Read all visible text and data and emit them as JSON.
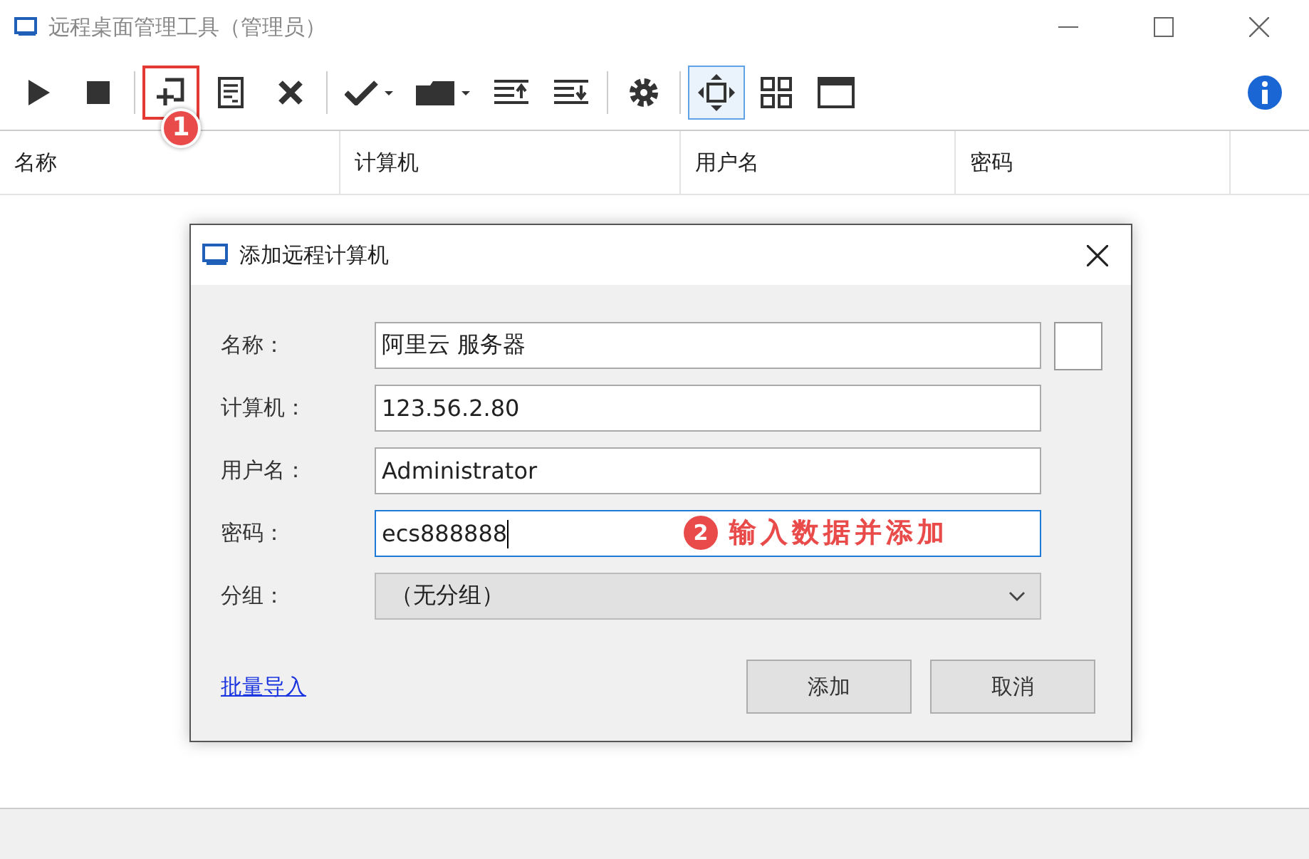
{
  "window": {
    "title": "远程桌面管理工具（管理员）"
  },
  "toolbar": [
    {
      "kind": "play",
      "selected": false
    },
    {
      "kind": "stop",
      "selected": false
    },
    {
      "kind": "separator"
    },
    {
      "kind": "add",
      "selected": false,
      "callout": "1"
    },
    {
      "kind": "properties",
      "selected": false
    },
    {
      "kind": "delete",
      "selected": false
    },
    {
      "kind": "separator"
    },
    {
      "kind": "check",
      "selected": false
    },
    {
      "kind": "folder",
      "selected": false
    },
    {
      "kind": "align-top",
      "selected": false
    },
    {
      "kind": "align-bottom",
      "selected": false
    },
    {
      "kind": "separator"
    },
    {
      "kind": "settings",
      "selected": false
    },
    {
      "kind": "separator"
    },
    {
      "kind": "fit",
      "selected": true
    },
    {
      "kind": "grid",
      "selected": false
    },
    {
      "kind": "window",
      "selected": false
    },
    {
      "kind": "spacer"
    },
    {
      "kind": "info",
      "selected": false
    }
  ],
  "table": {
    "columns": [
      "名称",
      "计算机",
      "用户名",
      "密码"
    ]
  },
  "dialog": {
    "title": "添加远程计算机",
    "fields": [
      {
        "kind": "text",
        "label": "名称：",
        "value": "阿里云 服务器",
        "focused": false,
        "swatch": true
      },
      {
        "kind": "text",
        "label": "计算机：",
        "value": "123.56.2.80",
        "focused": false
      },
      {
        "kind": "text",
        "label": "用户名：",
        "value": "Administrator",
        "focused": false
      },
      {
        "kind": "text",
        "label": "密码：",
        "value": "ecs888888",
        "focused": true,
        "callout": "2",
        "note": "输入数据并添加"
      },
      {
        "kind": "dropdown",
        "label": "分组：",
        "value": "（无分组）",
        "focused": false
      }
    ],
    "link": "批量导入",
    "buttons": [
      "添加",
      "取消"
    ]
  }
}
